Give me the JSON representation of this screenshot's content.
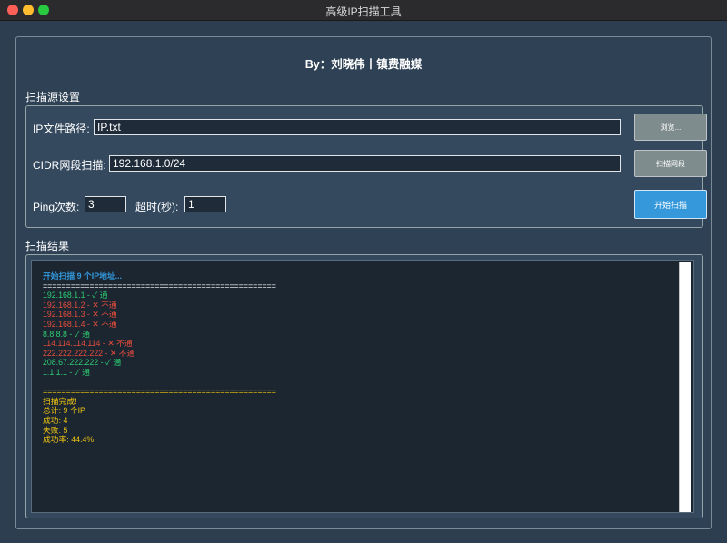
{
  "window": {
    "title": "高级IP扫描工具"
  },
  "header": {
    "author": "By：刘晓伟丨镇费融媒"
  },
  "source_section": {
    "label": "扫描源设置",
    "ip_file_label": "IP文件路径:",
    "ip_file_value": "IP.txt",
    "browse_button": "浏览...",
    "cidr_label": "CIDR网段扫描:",
    "cidr_value": "192.168.1.0/24",
    "scan_range_button": "扫描网段",
    "ping_label": "Ping次数:",
    "ping_value": "3",
    "timeout_label": "超时(秒):",
    "timeout_value": "1",
    "start_button": "开始扫描"
  },
  "results_section": {
    "label": "扫描结果",
    "log": [
      {
        "text": "开始扫描 9 个IP地址...",
        "color": "#3498db",
        "bold": true
      },
      {
        "text": "==================================================",
        "color": "#ffffff"
      },
      {
        "text": "192.168.1.1 - ✓ 通",
        "color": "#2ecc71"
      },
      {
        "text": "192.168.1.2 - ✕ 不通",
        "color": "#e74c3c"
      },
      {
        "text": "192.168.1.3 - ✕ 不通",
        "color": "#e74c3c"
      },
      {
        "text": "192.168.1.4 - ✕ 不通",
        "color": "#e74c3c"
      },
      {
        "text": "8.8.8.8 - ✓ 通",
        "color": "#2ecc71"
      },
      {
        "text": "114.114.114.114 - ✕ 不通",
        "color": "#e74c3c"
      },
      {
        "text": "222.222.222.222 - ✕ 不通",
        "color": "#e74c3c"
      },
      {
        "text": "208.67.222.222 - ✓ 通",
        "color": "#2ecc71"
      },
      {
        "text": "1.1.1.1 - ✓ 通",
        "color": "#2ecc71"
      },
      {
        "text": "",
        "color": "#ffffff"
      },
      {
        "text": "==================================================",
        "color": "#f1c40f"
      },
      {
        "text": "扫描完成!",
        "color": "#f1c40f"
      },
      {
        "text": "总计: 9 个IP",
        "color": "#f1c40f"
      },
      {
        "text": "成功: 4",
        "color": "#f1c40f"
      },
      {
        "text": "失败: 5",
        "color": "#f1c40f"
      },
      {
        "text": "成功率: 44.4%",
        "color": "#f1c40f"
      }
    ]
  }
}
